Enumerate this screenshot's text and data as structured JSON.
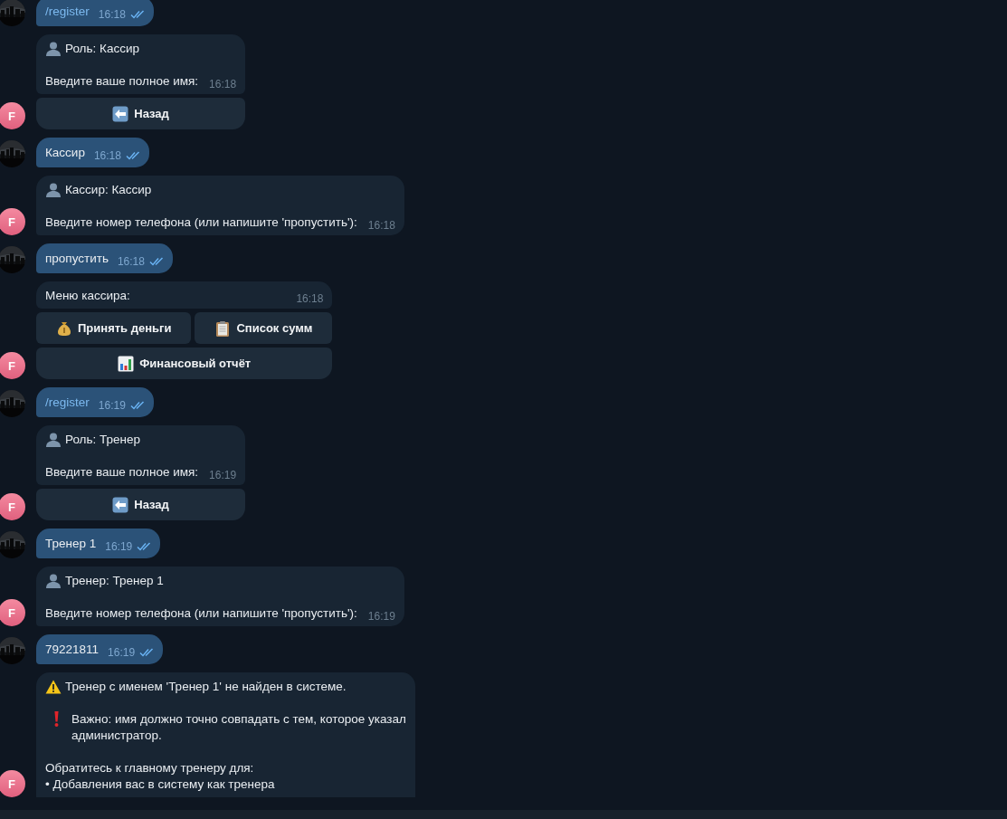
{
  "messages": [
    {
      "kind": "outgoing",
      "text": "/register",
      "command": true,
      "time": "16:18",
      "read": true
    },
    {
      "kind": "incoming",
      "avatar": "F",
      "paragraphs": [
        {
          "kind": "person",
          "text": "Роль: Кассир"
        },
        {
          "kind": "plain",
          "text": "Введите ваше полное имя:"
        }
      ],
      "time": "16:18",
      "keyboard": [
        [
          {
            "kind": "back-arrow",
            "label": "Назад"
          }
        ]
      ]
    },
    {
      "kind": "outgoing",
      "text": "Кассир",
      "command": false,
      "time": "16:18",
      "read": true
    },
    {
      "kind": "incoming",
      "avatar": "F",
      "paragraphs": [
        {
          "kind": "person",
          "text": "Кассир: Кассир"
        },
        {
          "kind": "plain",
          "text": "Введите номер телефона (или напишите 'пропустить'):"
        }
      ],
      "time": "16:18"
    },
    {
      "kind": "outgoing",
      "text": "пропустить",
      "command": false,
      "time": "16:18",
      "read": true
    },
    {
      "kind": "incoming",
      "avatar": "F",
      "paragraphs": [
        {
          "kind": "plain",
          "text": "Меню кассира:"
        }
      ],
      "time": "16:18",
      "keyboard": [
        [
          {
            "kind": "money-bag",
            "label": "Принять деньги"
          },
          {
            "kind": "clipboard",
            "label": "Список сумм"
          }
        ],
        [
          {
            "kind": "bar-chart",
            "label": "Финансовый отчёт"
          }
        ]
      ]
    },
    {
      "kind": "outgoing",
      "text": "/register",
      "command": true,
      "time": "16:19",
      "read": true
    },
    {
      "kind": "incoming",
      "avatar": "F",
      "paragraphs": [
        {
          "kind": "person",
          "text": "Роль: Тренер"
        },
        {
          "kind": "plain",
          "text": "Введите ваше полное имя:"
        }
      ],
      "time": "16:19",
      "keyboard": [
        [
          {
            "kind": "back-arrow",
            "label": "Назад"
          }
        ]
      ]
    },
    {
      "kind": "outgoing",
      "text": "Тренер 1",
      "command": false,
      "time": "16:19",
      "read": true
    },
    {
      "kind": "incoming",
      "avatar": "F",
      "paragraphs": [
        {
          "kind": "person",
          "text": "Тренер: Тренер 1"
        },
        {
          "kind": "plain",
          "text": "Введите номер телефона (или напишите 'пропустить'):"
        }
      ],
      "time": "16:19"
    },
    {
      "kind": "outgoing",
      "text": "79221811",
      "command": false,
      "time": "16:19",
      "read": true
    },
    {
      "kind": "incoming",
      "avatar": "F",
      "paragraphs": [
        {
          "kind": "warning",
          "text": "Тренер с именем 'Тренер 1' не найден в системе."
        },
        {
          "kind": "exclamation",
          "text": "Важно: имя должно точно совпадать с тем, которое указал\nадминистратор."
        },
        {
          "kind": "plain",
          "text": "Обратитесь к главному тренеру для:\n• Добавления вас в систему как тренера"
        }
      ]
    }
  ]
}
